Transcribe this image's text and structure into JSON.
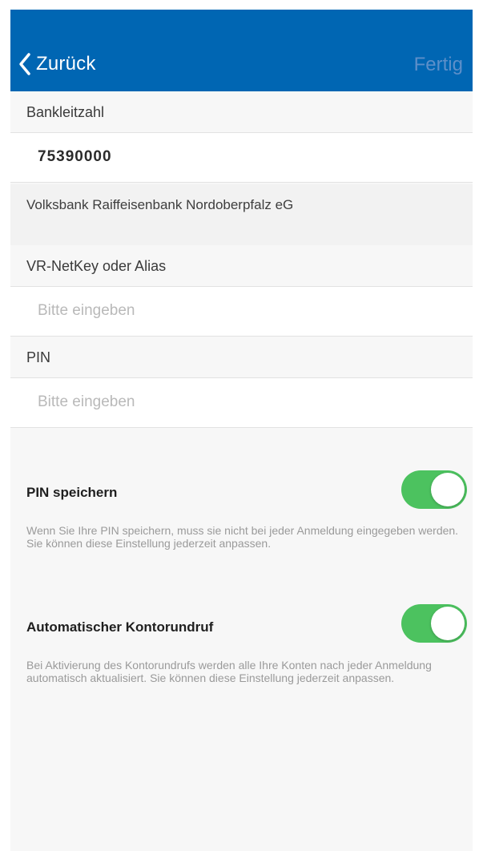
{
  "header": {
    "back_label": "Zurück",
    "done_label": "Fertig"
  },
  "bank": {
    "code_label": "Bankleitzahl",
    "code_value": "75390000",
    "name": "Volksbank Raiffeisenbank Nordoberpfalz eG"
  },
  "login": {
    "netkey_label": "VR-NetKey oder Alias",
    "netkey_placeholder": "Bitte eingeben",
    "pin_label": "PIN",
    "pin_placeholder": "Bitte eingeben"
  },
  "settings": [
    {
      "title": "PIN speichern",
      "description": "Wenn Sie Ihre PIN speichern, muss sie nicht bei jeder Anmeldung eingegeben werden. Sie können diese Einstellung jederzeit anpassen.",
      "enabled": true
    },
    {
      "title": "Automatischer Kontorundruf",
      "description": "Bei Aktivierung des Kontorundrufs werden alle Ihre Konten nach jeder Anmeldung automatisch aktualisiert. Sie können diese Einstellung jederzeit anpassen.",
      "enabled": true
    }
  ],
  "colors": {
    "header_bg": "#0066b3",
    "toggle_on": "#4cc25f",
    "done_text": "#5d8fc9"
  }
}
